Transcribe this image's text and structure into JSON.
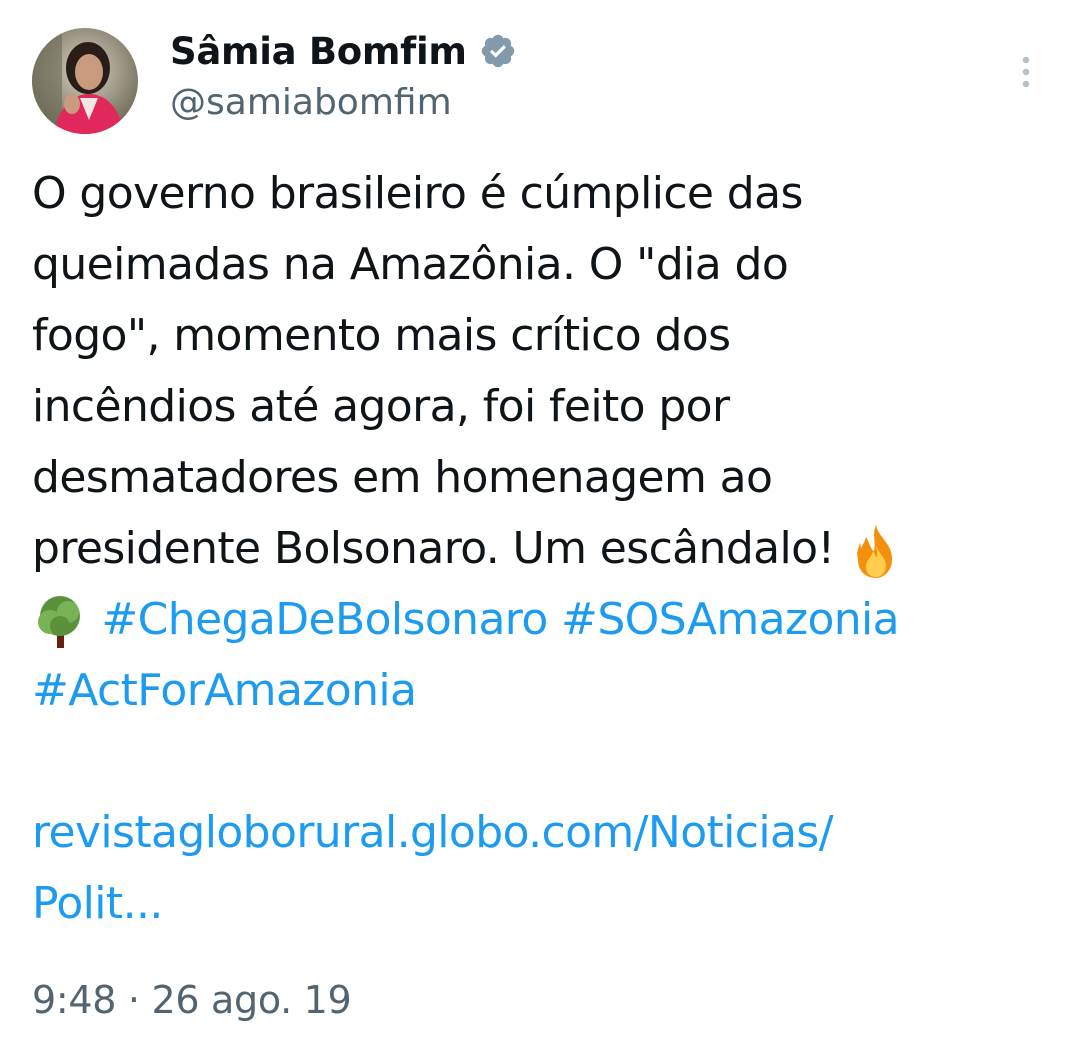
{
  "author": {
    "display_name": "Sâmia Bomfim",
    "handle": "@samiabomfim",
    "avatar_icon": "profile-photo",
    "verified_icon": "verified-badge-icon"
  },
  "menu": {
    "icon": "more-vertical-icon"
  },
  "tweet": {
    "line1": "O governo brasileiro é cúmplice das",
    "line2": "queimadas na Amazônia. O \"dia do",
    "line3": "fogo\", momento mais crítico dos",
    "line4": "incêndios até agora, foi feito por",
    "line5": "desmatadores em homenagem ao",
    "line6": "presidente Bolsonaro. Um escândalo!",
    "fire_emoji": "fire-emoji",
    "tree_emoji": "tree-emoji",
    "hashtags": [
      "#ChegaDeBolsonaro",
      "#SOSAmazonia",
      "#ActForAmazonia"
    ],
    "link_line1": "revistagloborural.globo.com/Noticias/",
    "link_line2": "Polit..."
  },
  "meta": {
    "time": "9:48",
    "separator": "·",
    "date": "26 ago. 19"
  },
  "colors": {
    "text": "#0f1419",
    "secondary": "#536471",
    "link": "#1d9bf0",
    "verified": "#829aab"
  }
}
